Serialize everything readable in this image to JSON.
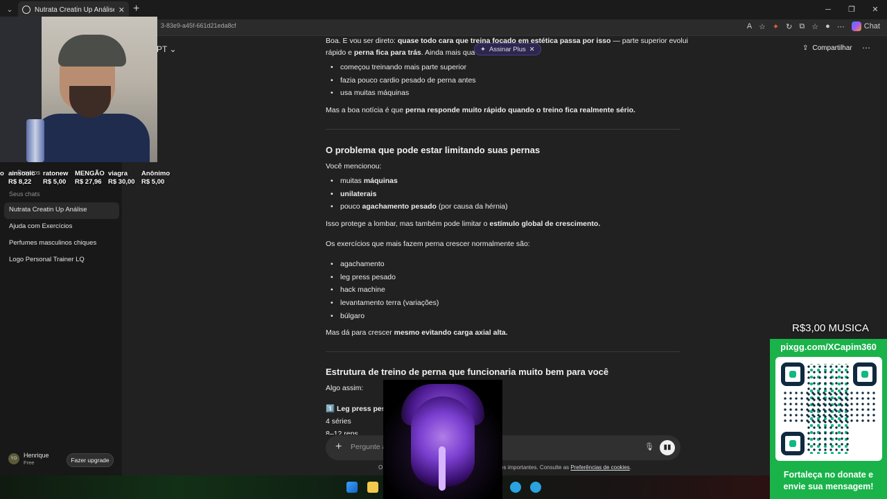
{
  "browser": {
    "tab_title": "Nutrata Creatin Up Análise",
    "url_fragment": "3-83e9-a45f-661d21eda8cf",
    "chat_button": "Chat"
  },
  "header": {
    "model_label": "PT",
    "assinar_plus": "Assinar Plus",
    "share_label": "Compartilhar"
  },
  "sidebar": {
    "projects_label": "Projetos",
    "section_label": "Seus chats",
    "chats": [
      "Nutrata Creatin Up Análise",
      "Ajuda com Exercícios",
      "Perfumes masculinos chiques",
      "Logo Personal Trainer LQ"
    ],
    "user_name": "Henrique",
    "user_plan": "Free",
    "user_initials": "YO",
    "upgrade_label": "Fazer upgrade"
  },
  "donations": [
    {
      "name": "o",
      "value": ""
    },
    {
      "name": "ainsonic",
      "value": "R$ 8,22"
    },
    {
      "name": "ratonew",
      "value": "R$ 5,00"
    },
    {
      "name": "MENGÃO",
      "value": "R$ 27,96"
    },
    {
      "name": "viagra",
      "value": "R$ 30,00"
    },
    {
      "name": "Anônimo",
      "value": "R$ 5,00"
    }
  ],
  "content": {
    "intro_1a": "Boa. E vou ser direto: ",
    "intro_1b": "quase todo cara que treina focado em estética passa por isso",
    "intro_1c": " — parte superior evolui",
    "intro_2a": "rápido e ",
    "intro_2b": "perna fica para trás",
    "intro_2c": ". Ainda mais qua",
    "bullets_1": [
      "começou treinando mais parte superior",
      "fazia pouco cardio pesado de perna antes",
      "usa muitas máquinas"
    ],
    "good_news_a": "Mas a boa notícia é que ",
    "good_news_b": "perna responde muito rápido quando o treino fica realmente sério.",
    "heading_1": "O problema que pode estar limitando suas pernas",
    "you_mentioned": "Você mencionou:",
    "b2_1a": "muitas ",
    "b2_1b": "máquinas",
    "b2_2": "unilaterais",
    "b2_3a": "pouco ",
    "b2_3b": "agachamento pesado",
    "b2_3c": " (por causa da hérnia)",
    "protects_a": "Isso protege a lombar, mas também pode limitar o ",
    "protects_b": "estímulo global de crescimento.",
    "exercises_intro": "Os exercícios que mais fazem perna crescer normalmente são:",
    "bullets_3": [
      "agachamento",
      "leg press pesado",
      "hack machine",
      "levantamento terra (variações)",
      "búlgaro"
    ],
    "grow_a": "Mas dá para crescer ",
    "grow_b": "mesmo evitando carga axial alta.",
    "heading_2": "Estrutura de treino de perna que funcionaria muito bem para você",
    "something_like": "Algo assim:",
    "step_1_num": "1️⃣",
    "step_1": "Leg press pes",
    "series": "4 séries",
    "reps": "8–12 reps"
  },
  "composer": {
    "placeholder": "Pergunte a",
    "footer_o": "O",
    "footer_text": "es importantes. Consulte as ",
    "footer_link": "Preferências de cookies",
    "footer_end": "."
  },
  "overlay": {
    "musica": "R$3,00 MUSICA",
    "pix_handle": "pixgg.com/XCapim360",
    "donate_msg_1": "Fortaleça no donate e",
    "donate_msg_2": "envie sua mensagem!"
  },
  "colors": {
    "background": "#212121",
    "sidebar": "#181818",
    "qr_green": "#19b34a",
    "plus_pill": "#2d2750"
  }
}
